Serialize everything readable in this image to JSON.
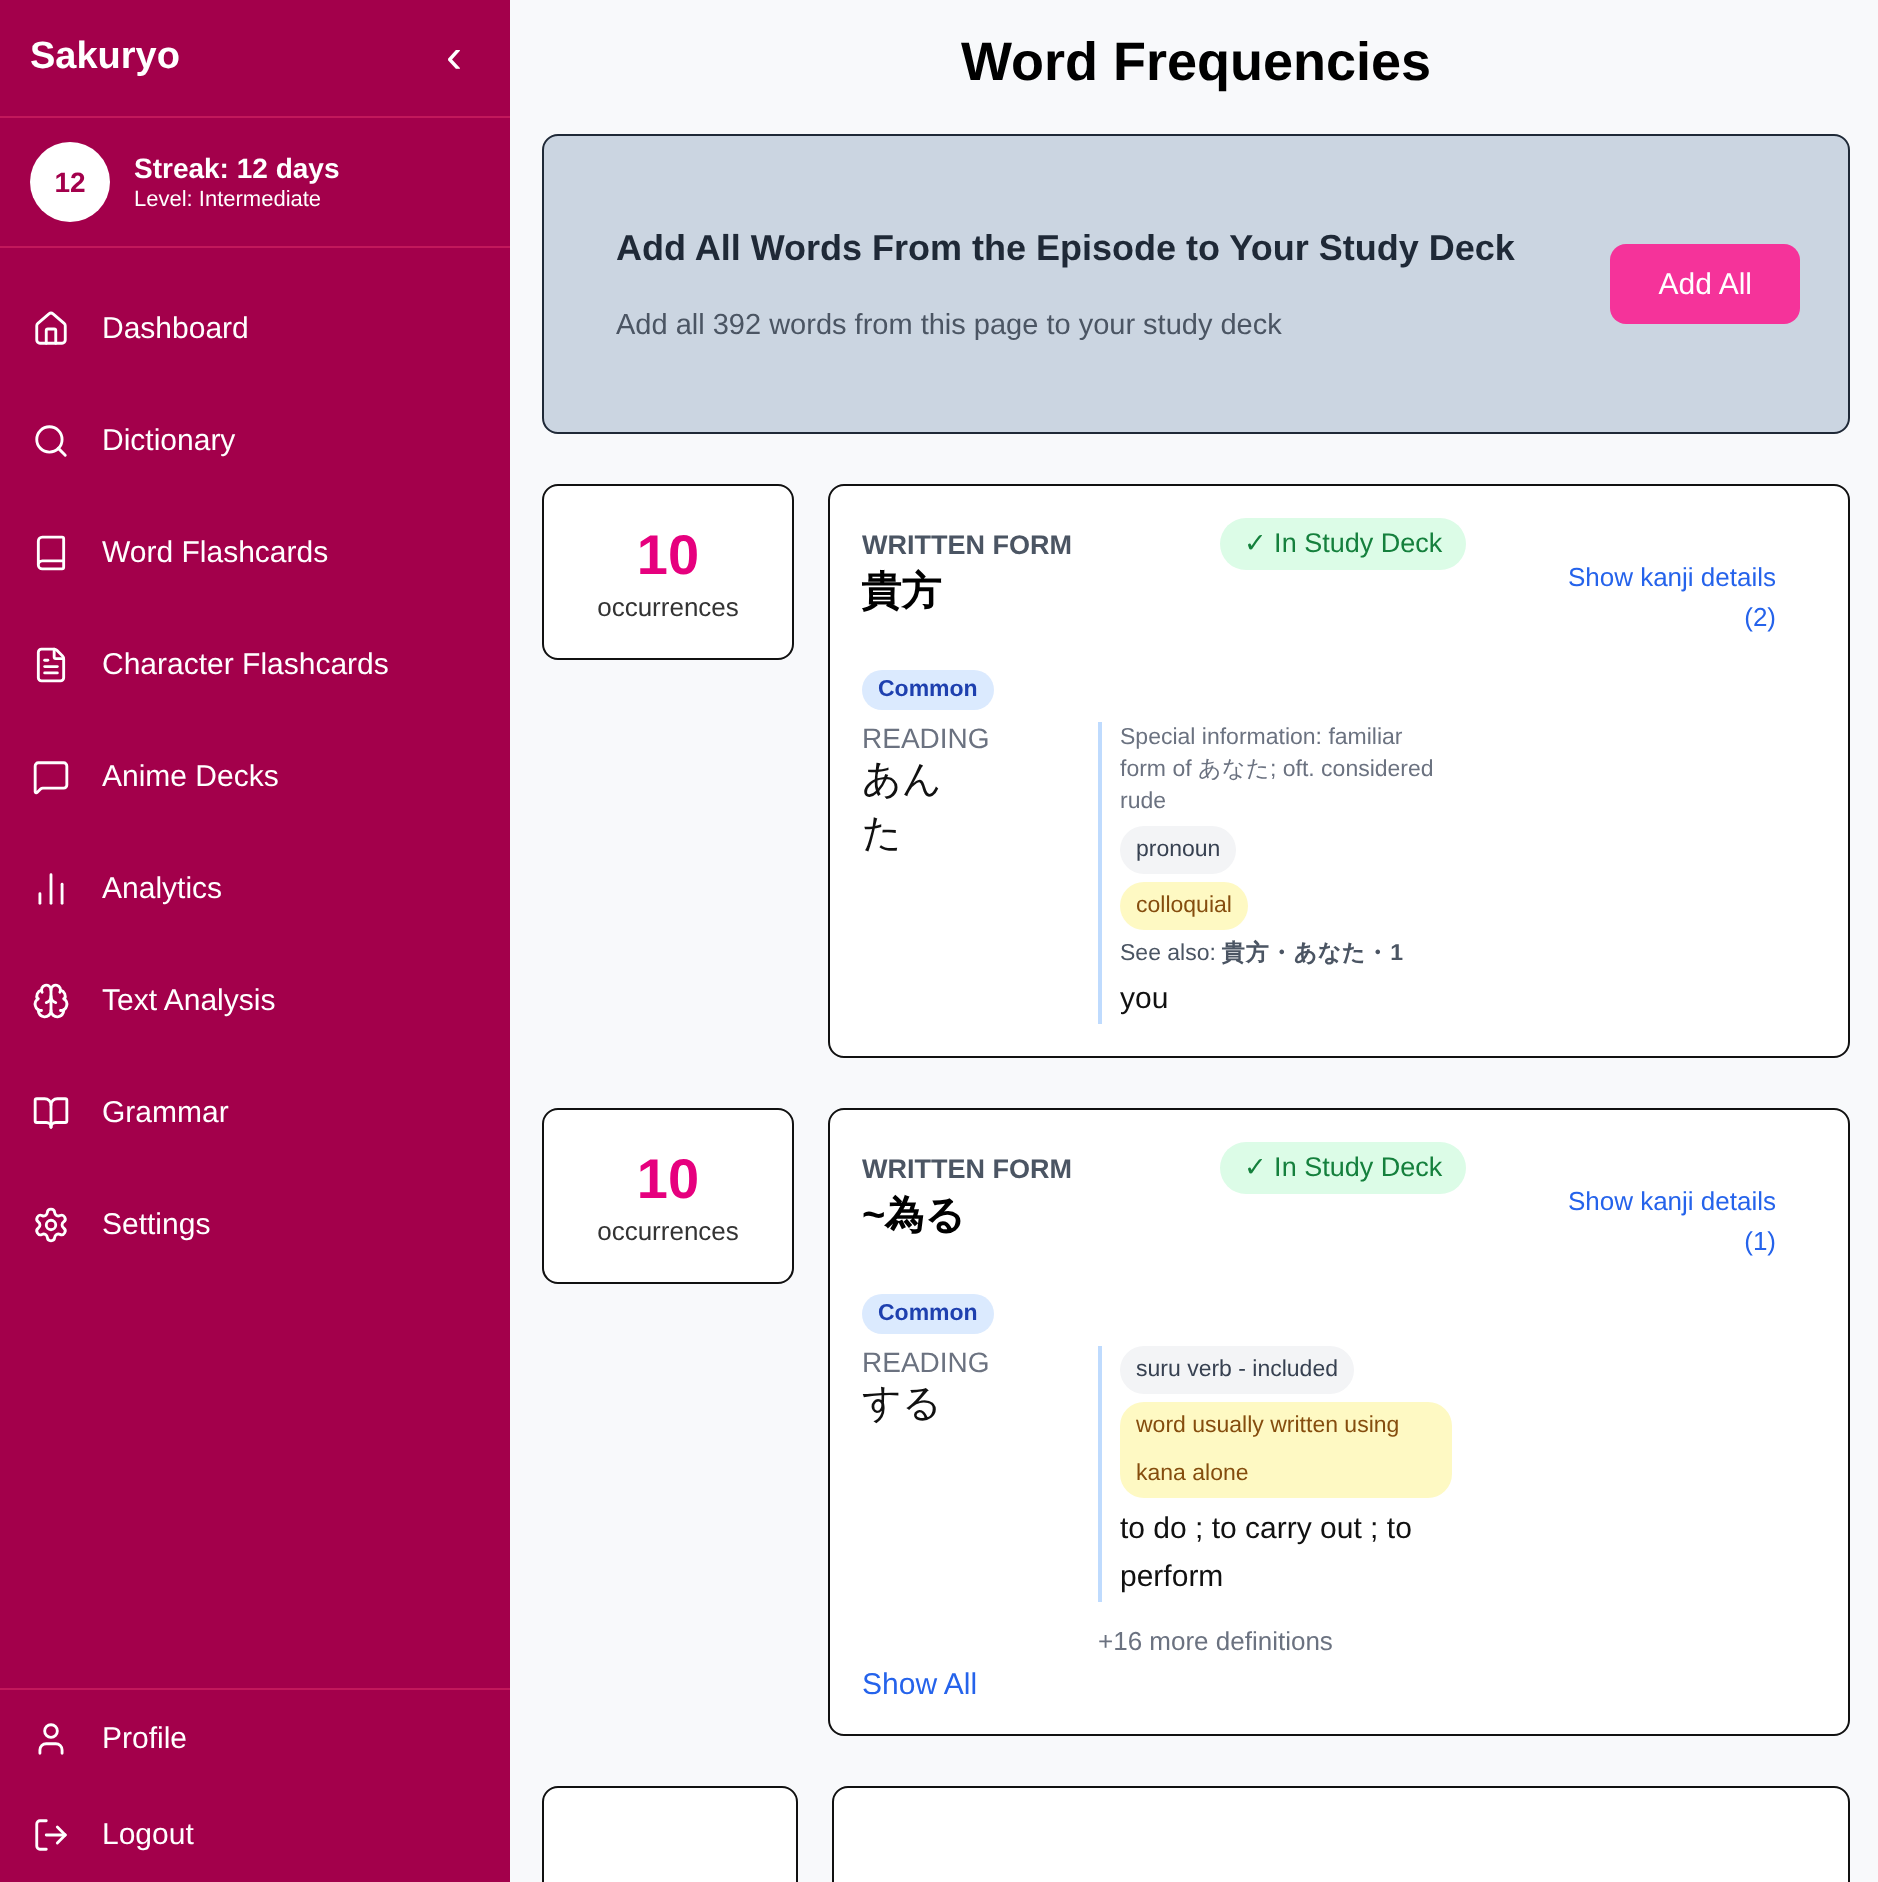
{
  "sidebar": {
    "brand": "Sakuryo",
    "collapse_icon": "‹",
    "streak": {
      "count": "12",
      "title": "Streak: 12 days",
      "level": "Level: Intermediate"
    },
    "items": [
      {
        "label": "Dashboard"
      },
      {
        "label": "Dictionary"
      },
      {
        "label": "Word Flashcards"
      },
      {
        "label": "Character Flashcards"
      },
      {
        "label": "Anime Decks"
      },
      {
        "label": "Analytics"
      },
      {
        "label": "Text Analysis"
      },
      {
        "label": "Grammar"
      },
      {
        "label": "Settings"
      }
    ],
    "footer_items": [
      {
        "label": "Profile"
      },
      {
        "label": "Logout"
      }
    ]
  },
  "title": "Word Frequencies",
  "banner": {
    "heading": "Add All Words From the Episode to Your Study Deck",
    "text": "Add all 392 words from this page to your study deck",
    "button": "Add All"
  },
  "entries": [
    {
      "count": "10",
      "count_label": "occurrences",
      "form_label": "WRITTEN FORM",
      "word": "貴方",
      "in_deck": true,
      "deck_label": "✓ In Study Deck",
      "kanji_link": "Show kanji details (2)",
      "common": "Common",
      "reading_label": "READING",
      "reading": "あんた",
      "senses": [
        {
          "info": "Special information: familiar form of あなた; oft. considered rude",
          "tags": [
            {
              "kind": "pos",
              "text": "pronoun"
            },
            {
              "kind": "misc",
              "text": "colloquial"
            }
          ],
          "see_also": "See also: **貴方・あなた・1**",
          "gloss": "you"
        }
      ]
    },
    {
      "count": "10",
      "count_label": "occurrences",
      "form_label": "WRITTEN FORM",
      "word": "~為る",
      "in_deck": true,
      "deck_label": "✓ In Study Deck",
      "kanji_link": "Show kanji details (1)",
      "common": "Common",
      "reading_label": "READING",
      "reading": "する",
      "senses": [
        {
          "tags": [
            {
              "kind": "pos",
              "text": "suru verb - included"
            },
            {
              "kind": "misc",
              "text": "word usually written using kana alone"
            }
          ],
          "gloss": "to do ; to carry out ; to perform"
        }
      ],
      "more": "+16 more definitions",
      "show_all": "Show All"
    }
  ]
}
